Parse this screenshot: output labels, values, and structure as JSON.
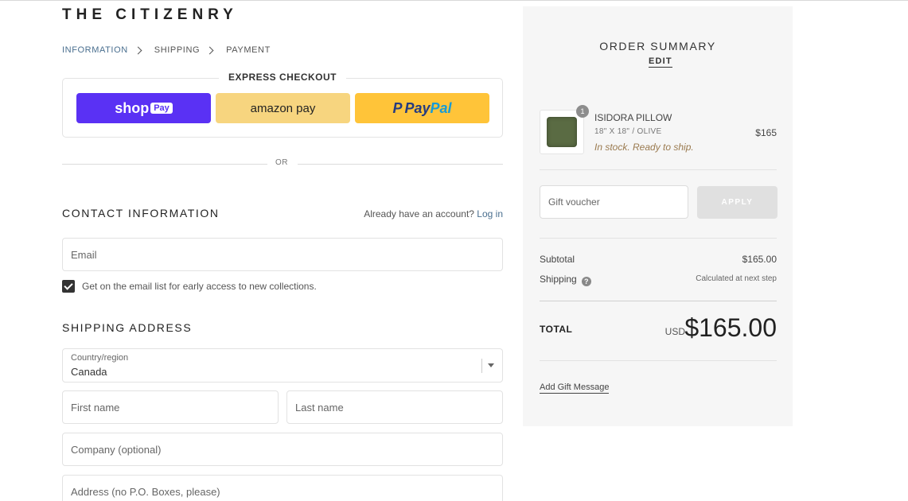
{
  "brand": {
    "name": "THE CITIZENRY"
  },
  "breadcrumb": {
    "items": [
      {
        "label": "INFORMATION",
        "active": true
      },
      {
        "label": "SHIPPING",
        "active": false
      },
      {
        "label": "PAYMENT",
        "active": false
      }
    ]
  },
  "express": {
    "title": "EXPRESS CHECKOUT",
    "shop_label": "shop",
    "shop_pay_label": "Pay",
    "amazon_label": "amazon pay",
    "paypal_label_1": "Pay",
    "paypal_label_2": "Pal",
    "shop_color": "#5a31f4",
    "amazon_color": "#f7d57f",
    "paypal_color": "#ffc439"
  },
  "divider": {
    "or_label": "OR"
  },
  "contact": {
    "title": "CONTACT INFORMATION",
    "account_prompt": "Already have an account?",
    "login_label": "Log in",
    "email_placeholder": "Email",
    "newsletter_label": "Get on the email list for early access to new collections.",
    "newsletter_checked": true
  },
  "shipping": {
    "title": "SHIPPING ADDRESS",
    "country_label": "Country/region",
    "country_value": "Canada",
    "first_name_placeholder": "First name",
    "last_name_placeholder": "Last name",
    "company_placeholder": "Company (optional)",
    "address_placeholder": "Address (no P.O. Boxes, please)"
  },
  "summary": {
    "title": "ORDER SUMMARY",
    "edit_label": "EDIT",
    "item": {
      "quantity": "1",
      "name": "ISIDORA PILLOW",
      "variant": "18\" X 18\" / OLIVE",
      "stock": "In stock. Ready to ship.",
      "price": "$165"
    },
    "voucher_placeholder": "Gift voucher",
    "apply_label": "APPLY",
    "subtotal_label": "Subtotal",
    "subtotal_value": "$165.00",
    "shipping_label": "Shipping",
    "shipping_help": "?",
    "shipping_value": "Calculated at next step",
    "total_label": "TOTAL",
    "total_currency": "USD",
    "total_value": "$165.00",
    "gift_message_label": "Add Gift Message"
  }
}
